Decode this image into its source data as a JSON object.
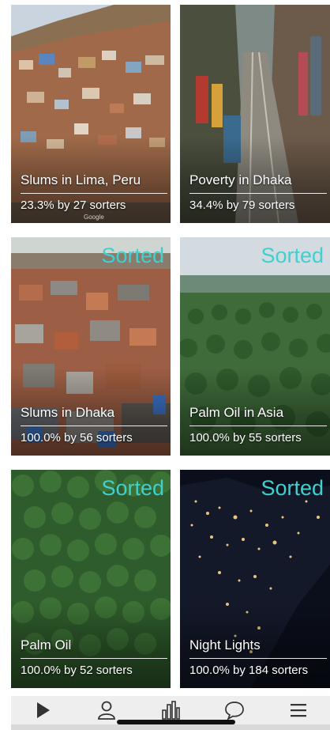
{
  "cards": [
    {
      "id": "lima",
      "title": "Slums in Lima, Peru",
      "stats": "23.3% by 27 sorters",
      "badge": "",
      "watermark": "Google",
      "colors": {
        "sky": "#c9d4de",
        "hill": "#8b6f52",
        "houses": "#a06a4a",
        "ground": "#6e5a48"
      }
    },
    {
      "id": "dhaka-poverty",
      "title": "Poverty in Dhaka",
      "stats": "34.4% by 79 sorters",
      "badge": "",
      "watermark": "",
      "colors": {
        "sky": "#7d8a86",
        "hill": "#4a4f3e",
        "houses": "#6c5a4a",
        "ground": "#5b5040"
      }
    },
    {
      "id": "dhaka-slums",
      "title": "Slums in Dhaka",
      "stats": "100.0% by 56 sorters",
      "badge": "Sorted",
      "watermark": "",
      "colors": {
        "sky": "#cfd6d2",
        "hill": "#8a7c6c",
        "houses": "#9c5e44",
        "ground": "#6e6152"
      }
    },
    {
      "id": "palm-asia",
      "title": "Palm Oil in Asia",
      "stats": "100.0% by 55 sorters",
      "badge": "Sorted",
      "watermark": "",
      "colors": {
        "sky": "#d3dbe0",
        "hill": "#3f6b3a",
        "houses": "#2f5a2c",
        "ground": "#2a4f25"
      }
    },
    {
      "id": "palm-oil",
      "title": "Palm Oil",
      "stats": "100.0% by 52 sorters",
      "badge": "Sorted",
      "watermark": "",
      "colors": {
        "sky": "#2f5c2c",
        "hill": "#3c7235",
        "houses": "#264a22",
        "ground": "#1f3f1c"
      }
    },
    {
      "id": "night-lights",
      "title": "Night Lights",
      "stats": "100.0% by 184 sorters",
      "badge": "Sorted",
      "watermark": "",
      "colors": {
        "sky": "#0b0f1c",
        "hill": "#14192a",
        "houses": "#e8c878",
        "ground": "#0d1120"
      }
    }
  ],
  "nav": [
    {
      "name": "play",
      "icon": "play-icon"
    },
    {
      "name": "profile",
      "icon": "user-icon"
    },
    {
      "name": "stats",
      "icon": "bar-chart-icon"
    },
    {
      "name": "chat",
      "icon": "speech-bubble-icon"
    },
    {
      "name": "menu",
      "icon": "hamburger-menu-icon"
    }
  ],
  "theme": {
    "badge_color": "#3fd0cf",
    "nav_bg": "#eeeeee",
    "icon_color": "#333333"
  }
}
